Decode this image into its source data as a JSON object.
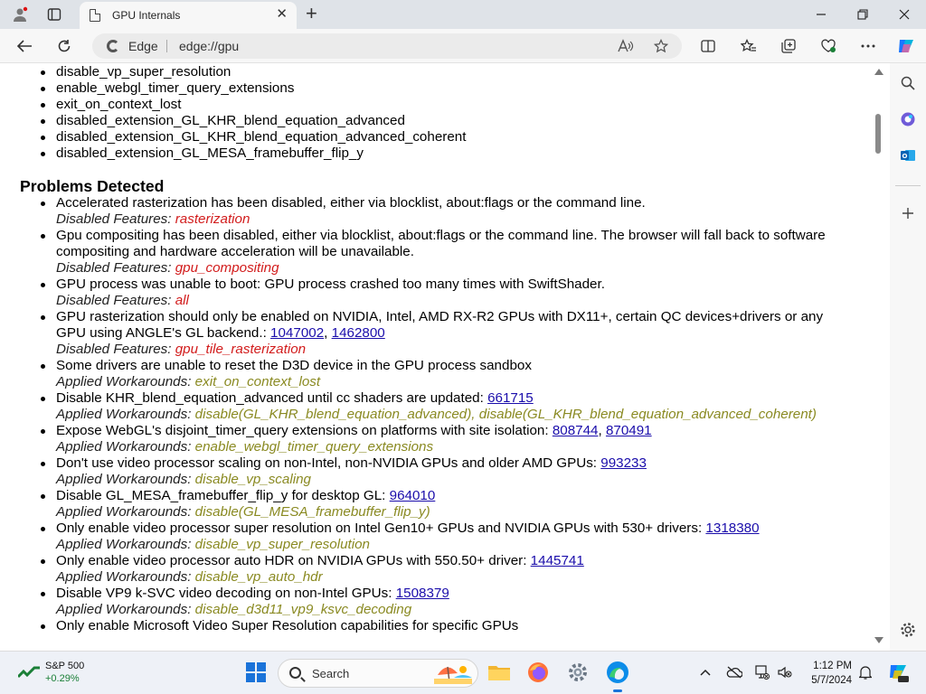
{
  "tab": {
    "title": "GPU Internals",
    "close": "✕",
    "new_tab": "+"
  },
  "window_controls": {
    "minimize": "—",
    "restore": "❐",
    "close": "✕"
  },
  "addressbar": {
    "site_name": "Edge",
    "url": "edge://gpu"
  },
  "workarounds_tail": [
    "disable_vp_super_resolution",
    "enable_webgl_timer_query_extensions",
    "exit_on_context_lost",
    "disabled_extension_GL_KHR_blend_equation_advanced",
    "disabled_extension_GL_KHR_blend_equation_advanced_coherent",
    "disabled_extension_GL_MESA_framebuffer_flip_y"
  ],
  "problems": {
    "heading": "Problems Detected",
    "items": [
      {
        "text": "Accelerated rasterization has been disabled, either via blocklist, about:flags or the command line.",
        "links": [],
        "kind_label": "Disabled Features:",
        "kind": "feature",
        "value": "rasterization"
      },
      {
        "text": "Gpu compositing has been disabled, either via blocklist, about:flags or the command line. The browser will fall back to software compositing and hardware acceleration will be unavailable.",
        "links": [],
        "kind_label": "Disabled Features:",
        "kind": "feature",
        "value": "gpu_compositing"
      },
      {
        "text": "GPU process was unable to boot: GPU process crashed too many times with SwiftShader.",
        "links": [],
        "kind_label": "Disabled Features:",
        "kind": "feature",
        "value": "all"
      },
      {
        "text": "GPU rasterization should only be enabled on NVIDIA, Intel, AMD RX-R2 GPUs with DX11+, certain QC devices+drivers or any GPU using ANGLE's GL backend.:",
        "links": [
          "1047002",
          "1462800"
        ],
        "kind_label": "Disabled Features:",
        "kind": "feature",
        "value": "gpu_tile_rasterization"
      },
      {
        "text": "Some drivers are unable to reset the D3D device in the GPU process sandbox",
        "links": [],
        "kind_label": "Applied Workarounds:",
        "kind": "workaround",
        "value": "exit_on_context_lost"
      },
      {
        "text": "Disable KHR_blend_equation_advanced until cc shaders are updated:",
        "links": [
          "661715"
        ],
        "kind_label": "Applied Workarounds:",
        "kind": "workaround",
        "value": "disable(GL_KHR_blend_equation_advanced), disable(GL_KHR_blend_equation_advanced_coherent)"
      },
      {
        "text": "Expose WebGL's disjoint_timer_query extensions on platforms with site isolation:",
        "links": [
          "808744",
          "870491"
        ],
        "kind_label": "Applied Workarounds:",
        "kind": "workaround",
        "value": "enable_webgl_timer_query_extensions"
      },
      {
        "text": "Don't use video processor scaling on non-Intel, non-NVIDIA GPUs and older AMD GPUs:",
        "links": [
          "993233"
        ],
        "kind_label": "Applied Workarounds:",
        "kind": "workaround",
        "value": "disable_vp_scaling"
      },
      {
        "text": "Disable GL_MESA_framebuffer_flip_y for desktop GL:",
        "links": [
          "964010"
        ],
        "kind_label": "Applied Workarounds:",
        "kind": "workaround",
        "value": "disable(GL_MESA_framebuffer_flip_y)"
      },
      {
        "text": "Only enable video processor super resolution on Intel Gen10+ GPUs and NVIDIA GPUs with 530+ drivers:",
        "links": [
          "1318380"
        ],
        "kind_label": "Applied Workarounds:",
        "kind": "workaround",
        "value": "disable_vp_super_resolution"
      },
      {
        "text": "Only enable video processor auto HDR on NVIDIA GPUs with 550.50+ driver:",
        "links": [
          "1445741"
        ],
        "kind_label": "Applied Workarounds:",
        "kind": "workaround",
        "value": "disable_vp_auto_hdr"
      },
      {
        "text": "Disable VP9 k-SVC video decoding on non-Intel GPUs:",
        "links": [
          "1508379"
        ],
        "kind_label": "Applied Workarounds:",
        "kind": "workaround",
        "value": "disable_d3d11_vp9_ksvc_decoding"
      },
      {
        "text": "Only enable Microsoft Video Super Resolution capabilities for specific GPUs",
        "links": [],
        "kind_label": "",
        "kind": "workaround",
        "value": ""
      }
    ]
  },
  "colors": {
    "feature": "#d21c1c",
    "workaround": "#8a8a22",
    "link": "#1a0dab",
    "start_blue": "#1a73d9"
  },
  "taskbar": {
    "stock_name": "S&P 500",
    "stock_change": "+0.29%",
    "search_placeholder": "Search",
    "time": "1:12 PM",
    "date": "5/7/2024"
  }
}
